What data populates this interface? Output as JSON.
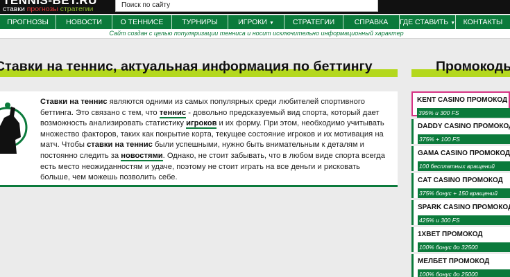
{
  "header": {
    "logo_title": "TENNIS-BET.RU",
    "logo_sub": [
      "ставки",
      "прогнозы",
      "стратегии"
    ],
    "search_placeholder": "Поиск по сайту"
  },
  "nav": {
    "items": [
      "ПРОГНОЗЫ",
      "НОВОСТИ",
      "О ТЕННИСЕ",
      "ТУРНИРЫ",
      "ИГРОКИ",
      "СТРАТЕГИИ",
      "СПРАВКА",
      "ГДЕ СТАВИТЬ",
      "КОНТАКТЫ"
    ],
    "dropdown_caret": "▼"
  },
  "notice": "Сайт создан с целью популяризации тенниса и носит исключительно информационный характер",
  "main": {
    "heading": "Ставки на теннис, актуальная информация по беттингу",
    "article": {
      "p1_b1": "Ставки на теннис",
      "p1_t1": " являются одними из самых популярных среди любителей спортивного беттинга. Это связано с тем, что ",
      "p1_l1": "теннис",
      "p1_t2": " - довольно предсказуемый вид спорта, который дает возможность анализировать статистику ",
      "p1_l2": "игроков",
      "p1_t3": " и их форму. При этом, необходимо учитывать множество факторов, таких как покрытие корта, текущее состояние игроков и их мотивация на матч. Чтобы ",
      "p1_b2": "ставки на теннис",
      "p1_t4": " были успешными, нужно быть внимательным к деталям и постоянно следить за ",
      "p1_l3": "новостями",
      "p1_t5": ". Однако, не стоит забывать, что в любом виде спорта всегда есть место неожиданностям и удаче, поэтому не стоит играть на все деньги и рисковать больше, чем можешь позволить себе."
    }
  },
  "sidebar": {
    "title": "Промокоды",
    "promos": [
      {
        "name": "KENT CASINO ПРОМОКОД",
        "bonus": "395% и 300 FS",
        "accent": "#d63384"
      },
      {
        "name": "DADDY CASINO ПРОМОКОД",
        "bonus": "375% + 100 FS",
        "accent": "#0b7a3b"
      },
      {
        "name": "GAMA CASINO ПРОМОКОД",
        "bonus": "100 бесплатных вращений",
        "accent": "#0b7a3b"
      },
      {
        "name": "CAT CASINO ПРОМОКОД",
        "bonus": "375% бонус + 150 вращений",
        "accent": "#0b7a3b"
      },
      {
        "name": "SPARK CASINO ПРОМОКОД",
        "bonus": "425% и 300 FS",
        "accent": "#0b7a3b"
      },
      {
        "name": "1XBET ПРОМОКОД",
        "bonus": "100% бонус до 32500",
        "accent": "#0b7a3b"
      },
      {
        "name": "МЕЛБЕТ ПРОМОКОД",
        "bonus": "100% бонус до 25000",
        "accent": "#0b7a3b"
      }
    ]
  },
  "colors": {
    "brand_green": "#0b7a3b",
    "accent_lime": "#b4d81e",
    "promo_pink": "#d63384"
  }
}
